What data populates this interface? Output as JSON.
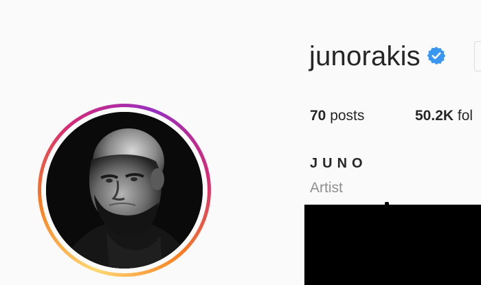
{
  "profile": {
    "username": "junorakis",
    "verified": true,
    "full_name": "JUNO",
    "category": "Artist"
  },
  "stats": {
    "posts_count": "70",
    "posts_label": "posts",
    "followers_count": "50.2K",
    "followers_label_visible": "fol"
  },
  "icons": {
    "verified": "verified-badge-icon"
  },
  "colors": {
    "verified_blue": "#3897f0",
    "ring_gradient": [
      "#feda75",
      "#fa7e1e",
      "#d62976",
      "#962fbf"
    ],
    "text_primary": "#262626",
    "text_secondary": "#8e8e8e",
    "background": "#fafafa"
  }
}
